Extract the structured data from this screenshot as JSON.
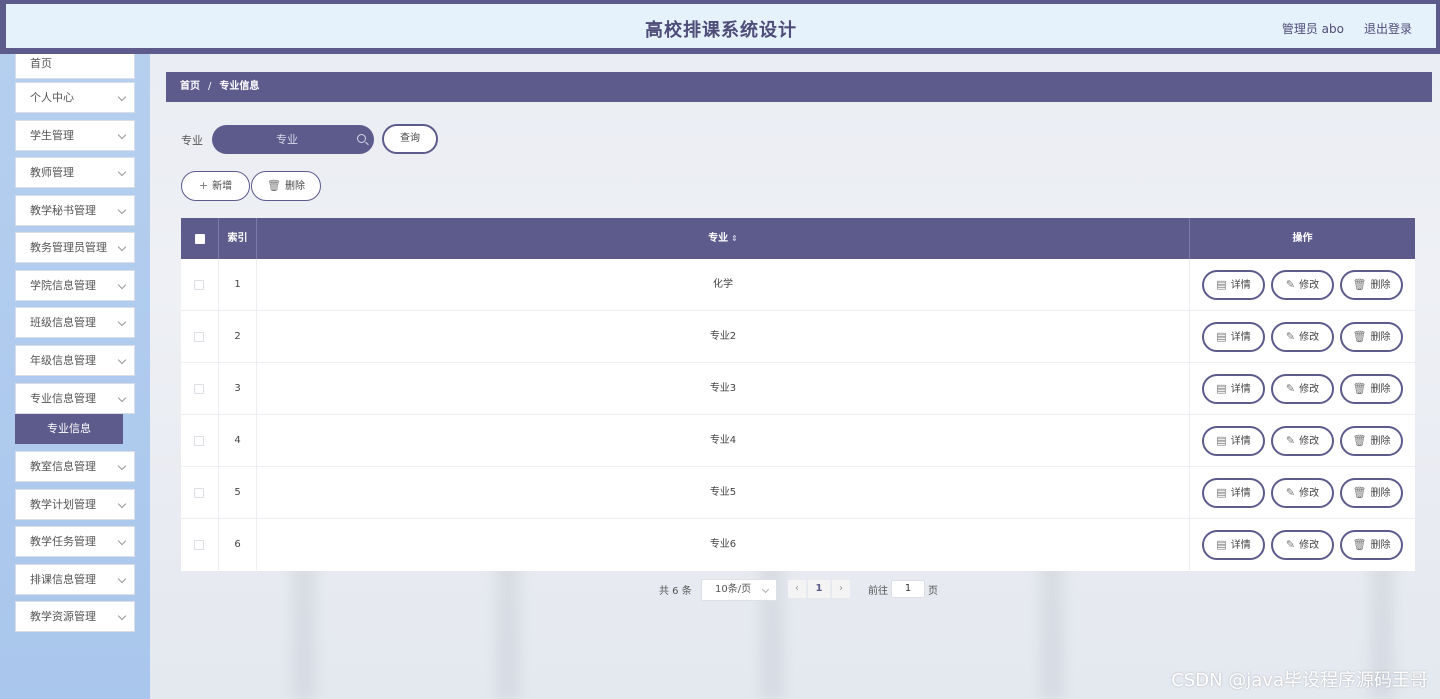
{
  "header": {
    "title": "高校排课系统设计",
    "user": "管理员 abo",
    "logout": "退出登录"
  },
  "sidebar": {
    "items": [
      {
        "label": "首页"
      },
      {
        "label": "个人中心"
      },
      {
        "label": "学生管理"
      },
      {
        "label": "教师管理"
      },
      {
        "label": "教学秘书管理"
      },
      {
        "label": "教务管理员管理"
      },
      {
        "label": "学院信息管理"
      },
      {
        "label": "班级信息管理"
      },
      {
        "label": "年级信息管理"
      },
      {
        "label": "专业信息管理"
      },
      {
        "label": "教室信息管理"
      },
      {
        "label": "教学计划管理"
      },
      {
        "label": "教学任务管理"
      },
      {
        "label": "排课信息管理"
      },
      {
        "label": "教学资源管理"
      }
    ],
    "active_sub": "专业信息"
  },
  "breadcrumb": {
    "home": "首页",
    "sep": "/",
    "current": "专业信息"
  },
  "search": {
    "label": "专业",
    "placeholder": "专业",
    "query_button": "查询"
  },
  "toolbar": {
    "add_label": "新增",
    "delete_label": "删除"
  },
  "table": {
    "columns": {
      "index": "索引",
      "major": "专业",
      "actions": "操作"
    },
    "rows": [
      {
        "index": "1",
        "major": "化学"
      },
      {
        "index": "2",
        "major": "专业2"
      },
      {
        "index": "3",
        "major": "专业3"
      },
      {
        "index": "4",
        "major": "专业4"
      },
      {
        "index": "5",
        "major": "专业5"
      },
      {
        "index": "6",
        "major": "专业6"
      }
    ],
    "actions": {
      "detail": "详情",
      "edit": "修改",
      "delete": "删除"
    }
  },
  "pagination": {
    "total": "共 6 条",
    "page_size": "10条/页",
    "current_page": "1",
    "goto_label": "前往",
    "goto_value": "1",
    "unit": "页",
    "prev_icon": "‹",
    "next_icon": "›"
  },
  "watermark": "CSDN @java毕设程序源码王哥",
  "colors": {
    "primary": "#5d5b8c",
    "header_bg": "#e6f2fb",
    "sidebar_bg": "#b5cfef"
  }
}
